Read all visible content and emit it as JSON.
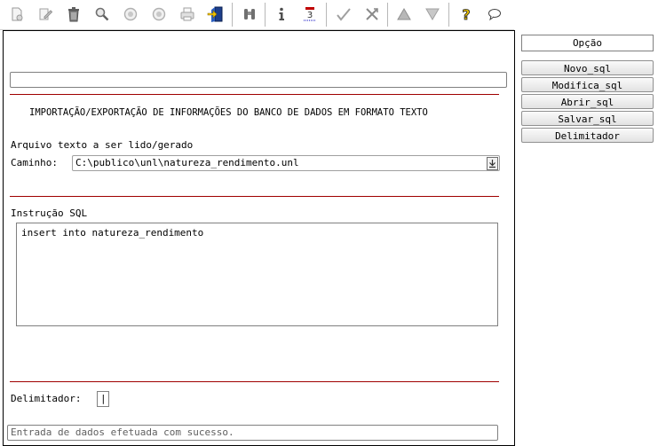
{
  "toolbar": {
    "icons": [
      "new-icon",
      "edit-icon",
      "delete-icon",
      "search-icon",
      "previous-icon",
      "next-icon",
      "print-icon",
      "exit-icon",
      "binoculars-icon",
      "info-icon",
      "calendar-icon",
      "confirm-icon",
      "cancel-icon",
      "up-icon",
      "down-icon",
      "help-icon",
      "comment-icon"
    ]
  },
  "form": {
    "heading": "IMPORTAÇÃO/EXPORTAÇÃO DE INFORMAÇÕES DO BANCO DE DADOS EM FORMATO TEXTO",
    "file_section_label": "Arquivo texto a ser lido/gerado",
    "path_label": "Caminho:",
    "path_value": "C:\\publico\\unl\\natureza_rendimento.unl",
    "sql_label": "Instrução SQL",
    "sql_value": "insert into natureza_rendimento",
    "delimiter_label": "Delimitador:",
    "delimiter_value": "|",
    "status_message": "Entrada de dados efetuada com sucesso."
  },
  "options": {
    "header": "Opção",
    "buttons": [
      "Novo_sql",
      "Modifica_sql",
      "Abrir_sql",
      "Salvar_sql",
      "Delimitador"
    ]
  },
  "colors": {
    "separator_line": "#a00000",
    "help_icon": "#e8c000"
  }
}
